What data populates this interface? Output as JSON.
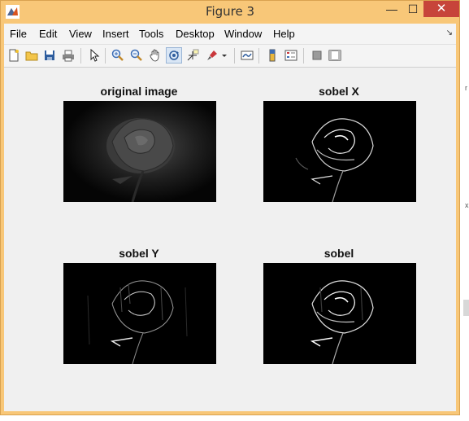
{
  "window": {
    "title": "Figure 3",
    "minimize_glyph": "—",
    "maximize_glyph": "☐",
    "close_glyph": "✕"
  },
  "menubar": {
    "items": [
      "File",
      "Edit",
      "View",
      "Insert",
      "Tools",
      "Desktop",
      "Window",
      "Help"
    ],
    "dock_arrow": "↘"
  },
  "toolbar": {
    "icons": [
      "new-figure-icon",
      "open-file-icon",
      "save-icon",
      "print-icon",
      "edit-plot-arrow-icon",
      "zoom-in-icon",
      "zoom-out-icon",
      "pan-hand-icon",
      "rotate-3d-icon",
      "data-cursor-icon",
      "brush-icon",
      "brush-dropdown-icon",
      "link-plot-icon",
      "insert-colorbar-icon",
      "insert-legend-icon",
      "hide-plot-tools-icon",
      "show-plot-tools-icon"
    ],
    "active": "rotate-3d-icon"
  },
  "axes": [
    {
      "title": "original image",
      "image": "rose-grayscale"
    },
    {
      "title": "sobel X",
      "image": "rose-sobel-x-edges"
    },
    {
      "title": "sobel Y",
      "image": "rose-sobel-y-edges"
    },
    {
      "title": "sobel",
      "image": "rose-sobel-magnitude"
    }
  ],
  "colors": {
    "title_bar": "#f8c778",
    "close_button": "#c7443a",
    "figure_bg": "#f0f0f0",
    "image_bg": "#000000"
  }
}
